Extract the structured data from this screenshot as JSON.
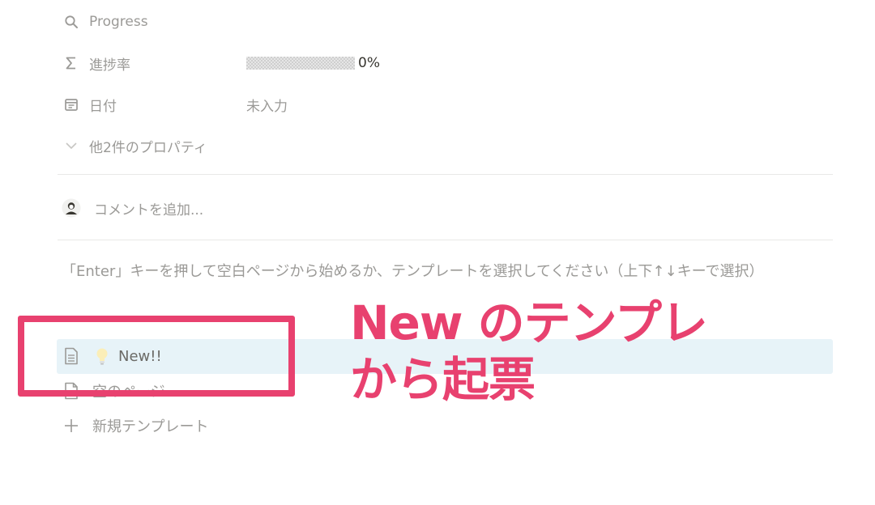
{
  "properties": [
    {
      "icon": "search-icon",
      "label": "Progress",
      "value": ""
    },
    {
      "icon": "sigma-icon",
      "label": "進捗率",
      "value": "0%",
      "progress": 0
    },
    {
      "icon": "calendar-icon",
      "label": "日付",
      "value": "未入力"
    },
    {
      "icon": "chevron-down-icon",
      "label": "他2件のプロパティ",
      "value": ""
    }
  ],
  "comment": {
    "placeholder": "コメントを追加..."
  },
  "template_hint": "「Enter」キーを押して空白ページから始めるか、テンプレートを選択してください（上下↑↓キーで選択）",
  "templates": [
    {
      "icon": "page-icon",
      "emoji": "💡",
      "label": "New!!",
      "selected": true
    },
    {
      "icon": "page-icon",
      "label": "空のページ",
      "selected": false
    }
  ],
  "new_template": {
    "icon": "plus-icon",
    "label": "新規テンプレート"
  },
  "annotation": {
    "line1": "New のテンプレ",
    "line2": "から起票",
    "color": "#e8416f"
  },
  "colors": {
    "muted": "#9b9a97",
    "highlight": "#e7f3f8",
    "accent": "#e8416f"
  }
}
